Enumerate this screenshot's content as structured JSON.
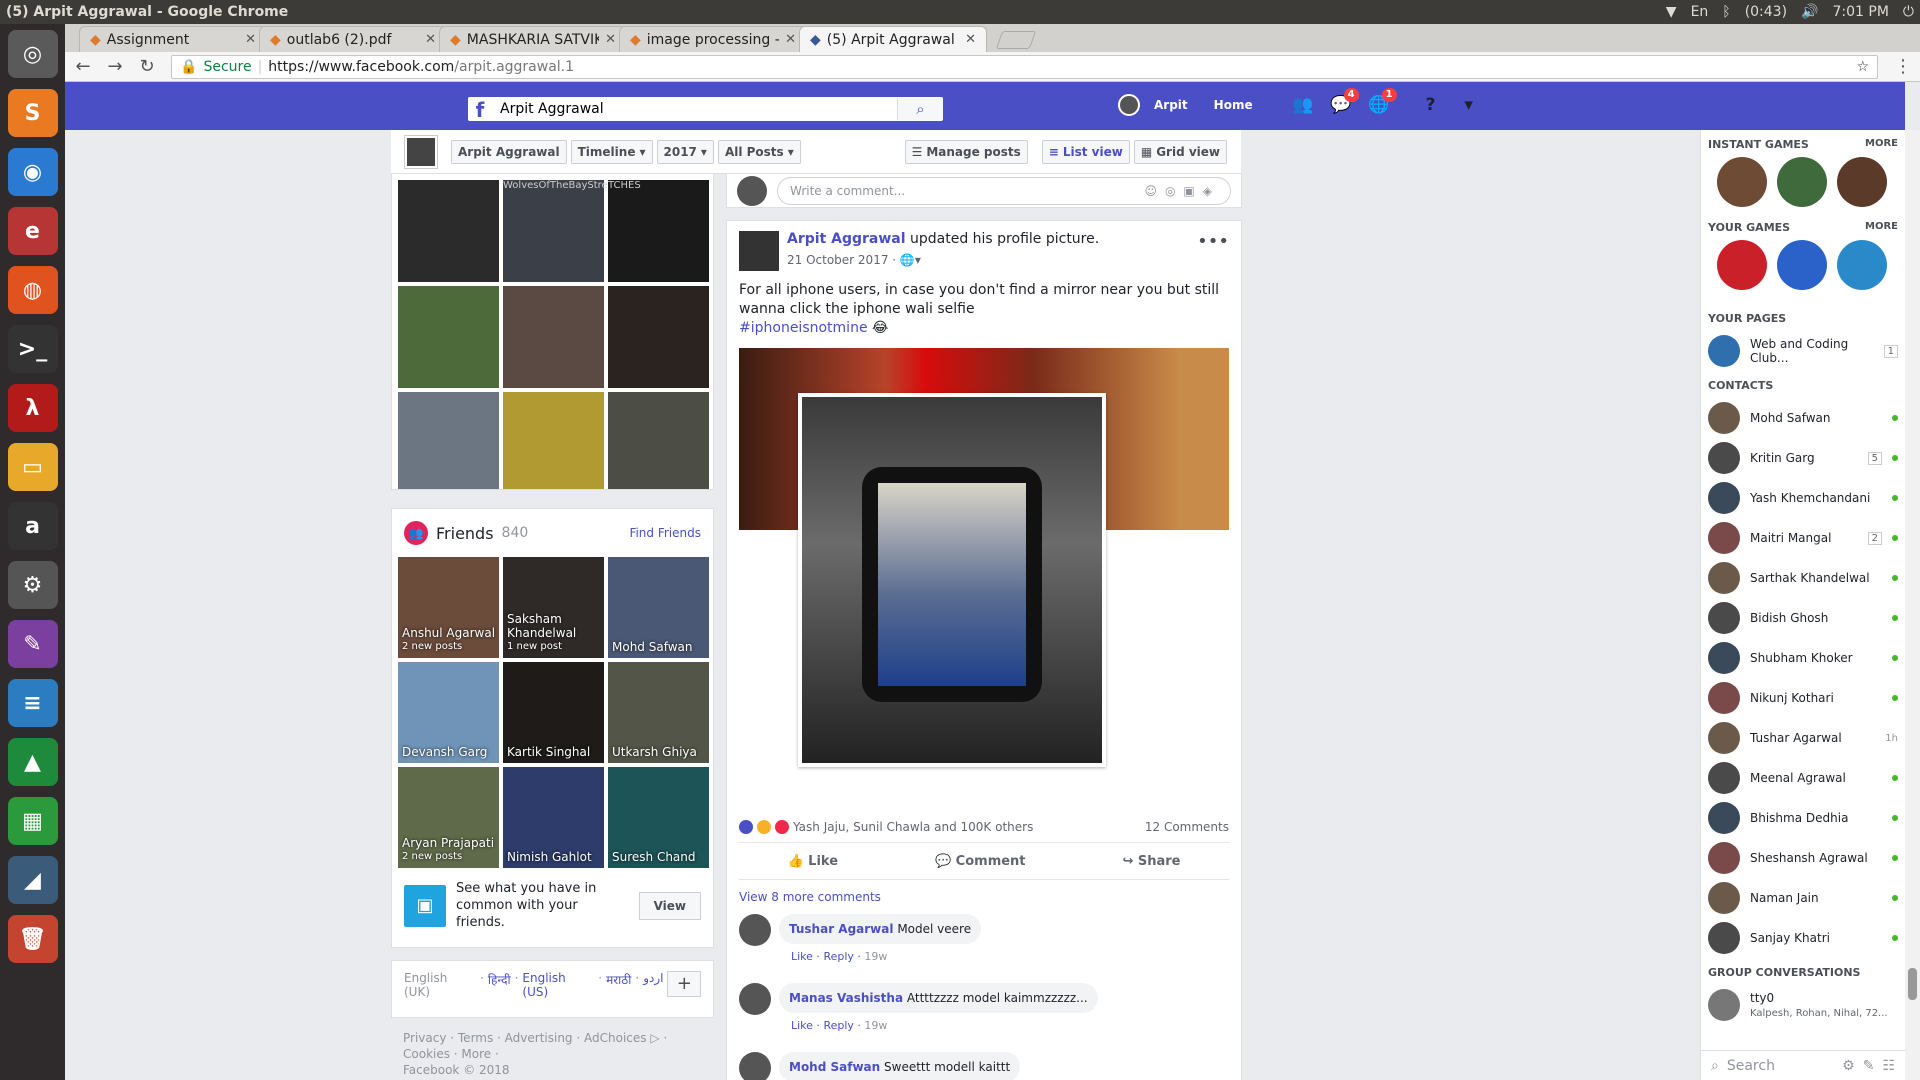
{
  "os": {
    "window_title": "(5) Arpit Aggrawal - Google Chrome",
    "keyboard": "En",
    "battery": "(0:43)",
    "time": "7:01 PM",
    "user": "arpit"
  },
  "launcher": [
    {
      "name": "ubuntu-dash-icon",
      "glyph": "◎",
      "color": "#5a5a5a"
    },
    {
      "name": "sublime-text-icon",
      "glyph": "S",
      "color": "#e97a21"
    },
    {
      "name": "chrome-icon",
      "glyph": "◉",
      "color": "#2a7ad1"
    },
    {
      "name": "pdf-reader-icon",
      "glyph": "e",
      "color": "#b73535"
    },
    {
      "name": "firefox-icon",
      "glyph": "◍",
      "color": "#e0531f"
    },
    {
      "name": "terminal-icon",
      "glyph": ">_",
      "color": "#333"
    },
    {
      "name": "filezilla-icon",
      "glyph": "λ",
      "color": "#b31b1b"
    },
    {
      "name": "files-icon",
      "glyph": "▭",
      "color": "#e8a92b"
    },
    {
      "name": "amazon-icon",
      "glyph": "a",
      "color": "#333"
    },
    {
      "name": "settings-toggle-icon",
      "glyph": "⚙",
      "color": "#555"
    },
    {
      "name": "text-editor-icon",
      "glyph": "✎",
      "color": "#7b3fa0"
    },
    {
      "name": "writer-icon",
      "glyph": "≡",
      "color": "#2c7cc1"
    },
    {
      "name": "image-viewer-icon",
      "glyph": "▲",
      "color": "#1e8a3c"
    },
    {
      "name": "calc-icon",
      "glyph": "▦",
      "color": "#2a9a3d"
    },
    {
      "name": "matlab-icon",
      "glyph": "◢",
      "color": "#3a5c7a"
    },
    {
      "name": "trash-icon",
      "glyph": "🗑",
      "color": "#c4442f"
    }
  ],
  "tabs": [
    {
      "label": "Assignment",
      "active": false
    },
    {
      "label": "outlab6 (2).pdf",
      "active": false
    },
    {
      "label": "MASHKARIA SATVIK",
      "active": false
    },
    {
      "label": "image processing -",
      "active": false
    },
    {
      "label": "(5) Arpit Aggrawal",
      "active": true
    }
  ],
  "address": {
    "secure": "Secure",
    "host": "https://www.facebook.com",
    "path": "/arpit.aggrawal.1"
  },
  "fb": {
    "search_value": "Arpit Aggrawal",
    "user": "Arpit",
    "home": "Home",
    "messages_badge": "4",
    "notif_badge": "1"
  },
  "subbar": {
    "name": "Arpit Aggrawal",
    "timeline": "Timeline",
    "year": "2017",
    "filter": "All Posts",
    "manage": "Manage posts",
    "list_view": "List view",
    "grid_view": "Grid view"
  },
  "photos": [
    {
      "color": "#2b2b2b",
      "caption": ""
    },
    {
      "color": "#3b3f48",
      "caption": "WolvesOfTheBayStre"
    },
    {
      "color": "#1a1a1a",
      "caption": "TCHES"
    },
    {
      "color": "#4d6b3a",
      "caption": ""
    },
    {
      "color": "#5b4a43",
      "caption": ""
    },
    {
      "color": "#2a231f",
      "caption": ""
    },
    {
      "color": "#6b7682",
      "caption": ""
    },
    {
      "color": "#b29a33",
      "caption": ""
    },
    {
      "color": "#4c4e45",
      "caption": ""
    }
  ],
  "friends": {
    "title": "Friends",
    "count": "840",
    "find": "Find Friends",
    "list": [
      {
        "name": "Anshul Agarwal",
        "note": "2 new posts",
        "color": "#6b4b3a"
      },
      {
        "name": "Saksham Khandelwal",
        "note": "1 new post",
        "color": "#2f2a28"
      },
      {
        "name": "Mohd Safwan",
        "note": "",
        "color": "#4a5875"
      },
      {
        "name": "Devansh Garg",
        "note": "",
        "color": "#6f94b8"
      },
      {
        "name": "Kartik Singhal",
        "note": "",
        "color": "#1e1b18"
      },
      {
        "name": "Utkarsh Ghiya",
        "note": "",
        "color": "#535548"
      },
      {
        "name": "Aryan Prajapati",
        "note": "2 new posts",
        "color": "#5f6a4a"
      },
      {
        "name": "Nimish Gahlot",
        "note": "",
        "color": "#2d3c6a"
      },
      {
        "name": "Suresh Chand",
        "note": "",
        "color": "#1c5458"
      }
    ],
    "common_text": "See what you have in common with your friends.",
    "view": "View"
  },
  "languages": [
    "English (UK)",
    "हिन्दी",
    "English (US)",
    "मराठी",
    "اردو"
  ],
  "footer": {
    "links": "Privacy · Terms · Advertising · AdChoices ▷ · Cookies · More ·",
    "copyright": "Facebook © 2018"
  },
  "post": {
    "comment_placeholder": "Write a comment...",
    "author": "Arpit Aggrawal",
    "action": "updated his profile picture.",
    "date": "21 October 2017",
    "text": "For all iphone users, in case you don't find a mirror near you but still wanna click the iphone wali selfie",
    "hashtag": "#iphoneisnotmine",
    "emoji": "😂",
    "reactions": "Yash Jaju, Sunil Chawla and 100K others",
    "comments_count": "12 Comments",
    "like": "Like",
    "comment": "Comment",
    "share": "Share",
    "view_more": "View 8 more comments",
    "comments": [
      {
        "author": "Tushar Agarwal",
        "text": "Model veere",
        "like": "Like",
        "reply": "Reply",
        "time": "19w"
      },
      {
        "author": "Manas Vashistha",
        "text": "Attttzzzz model kaimmzzzzz...",
        "like": "Like",
        "reply": "Reply",
        "time": "19w"
      },
      {
        "author": "Mohd Safwan",
        "text": "Sweettt modell kaittt",
        "like": "",
        "reply": "",
        "time": ""
      }
    ]
  },
  "sidebar": {
    "instant_games": "INSTANT GAMES",
    "your_games": "YOUR GAMES",
    "more": "MORE",
    "your_pages": "YOUR PAGES",
    "page_name": "Web and Coding Club...",
    "page_badge": "1",
    "contacts_title": "CONTACTS",
    "contacts": [
      {
        "name": "Mohd Safwan",
        "badge": "",
        "time": "",
        "online": true
      },
      {
        "name": "Kritin Garg",
        "badge": "5",
        "time": "",
        "online": true
      },
      {
        "name": "Yash Khemchandani",
        "badge": "",
        "time": "",
        "online": true
      },
      {
        "name": "Maitri Mangal",
        "badge": "2",
        "time": "",
        "online": true
      },
      {
        "name": "Sarthak Khandelwal",
        "badge": "",
        "time": "",
        "online": true
      },
      {
        "name": "Bidish Ghosh",
        "badge": "",
        "time": "",
        "online": true
      },
      {
        "name": "Shubham Khoker",
        "badge": "",
        "time": "",
        "online": true
      },
      {
        "name": "Nikunj Kothari",
        "badge": "",
        "time": "",
        "online": true
      },
      {
        "name": "Tushar Agarwal",
        "badge": "",
        "time": "1h",
        "online": false
      },
      {
        "name": "Meenal Agrawal",
        "badge": "",
        "time": "",
        "online": true
      },
      {
        "name": "Bhishma Dedhia",
        "badge": "",
        "time": "",
        "online": true
      },
      {
        "name": "Sheshansh Agrawal",
        "badge": "",
        "time": "",
        "online": true
      },
      {
        "name": "Naman Jain",
        "badge": "",
        "time": "",
        "online": true
      },
      {
        "name": "Sanjay Khatri",
        "badge": "",
        "time": "",
        "online": true
      }
    ],
    "group_title": "GROUP CONVERSATIONS",
    "group_name": "tty0",
    "group_members": "Kalpesh, Rohan, Nihal, 72...",
    "search": "Search"
  }
}
